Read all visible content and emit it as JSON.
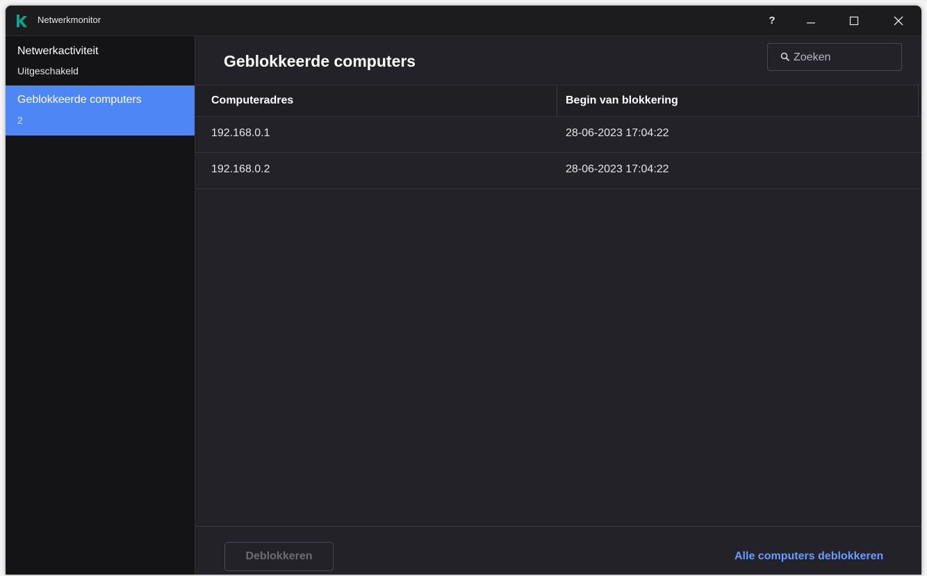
{
  "window": {
    "title": "Netwerkmonitor",
    "help_label": "?"
  },
  "sidebar": {
    "items": [
      {
        "label": "Netwerkactiviteit",
        "sub": "Uitgeschakeld",
        "selected": false
      },
      {
        "label": "Geblokkeerde computers",
        "sub": "2",
        "selected": true
      }
    ]
  },
  "main": {
    "title": "Geblokkeerde computers",
    "search": {
      "placeholder": "Zoeken",
      "value": ""
    },
    "table": {
      "columns": [
        "Computeradres",
        "Begin van blokkering"
      ],
      "rows": [
        [
          "192.168.0.1",
          "28-06-2023 17:04:22"
        ],
        [
          "192.168.0.2",
          "28-06-2023 17:04:22"
        ]
      ]
    },
    "footer": {
      "unblock_label": "Deblokkeren",
      "unblock_all_label": "Alle computers deblokkeren"
    }
  },
  "colors": {
    "accent": "#4f86f5",
    "link": "#6a9cff",
    "logo": "#00a88e",
    "background": "#222228",
    "sidebar": "#141416"
  },
  "icons": {
    "app": "kaspersky-k-logo",
    "search": "search-icon",
    "minimize": "minimize-icon",
    "maximize": "maximize-icon",
    "close": "close-icon"
  }
}
